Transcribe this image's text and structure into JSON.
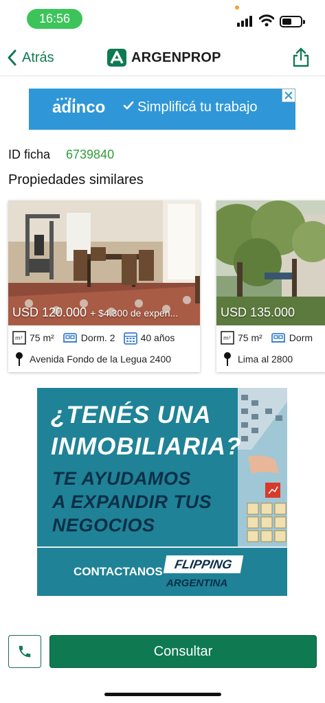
{
  "status_bar": {
    "time": "16:56",
    "accent_color": "#3cc45a",
    "icons": [
      "signal-icon",
      "wifi-icon",
      "battery-icon"
    ]
  },
  "nav": {
    "back_label": "Atrás",
    "brand": "ARGENPROP",
    "brand_color": "#0f7a52",
    "share_icon": "share-icon"
  },
  "ad_top": {
    "brand": "adinco",
    "slogan": "Simplificá tu trabajo",
    "color": "#2f97d8"
  },
  "listing": {
    "id_label": "ID ficha",
    "id_value": "6739840"
  },
  "similar": {
    "title": "Propiedades similares",
    "items": [
      {
        "price": "USD 120.000",
        "expenses": "+ $4.300 de expen...",
        "area": "75 m²",
        "bedrooms": "Dorm. 2",
        "age": "40 años",
        "address": "Avenida Fondo de la Legua 2400"
      },
      {
        "price": "USD 135.000",
        "expenses": "",
        "area": "75 m²",
        "bedrooms": "Dorm",
        "age": "",
        "address": "Lima al 2800"
      }
    ]
  },
  "ad_big": {
    "line1": "¿TENÉS UNA",
    "line2": "INMOBILIARIA?",
    "line3": "TE AYUDAMOS",
    "line4": "A EXPANDIR TUS",
    "line5": "NEGOCIOS",
    "cta": "CONTACTANOS",
    "brand": "FLIPPING",
    "brand_sub": "ARGENTINA"
  },
  "actions": {
    "call_icon": "phone-icon",
    "consult_label": "Consultar"
  }
}
